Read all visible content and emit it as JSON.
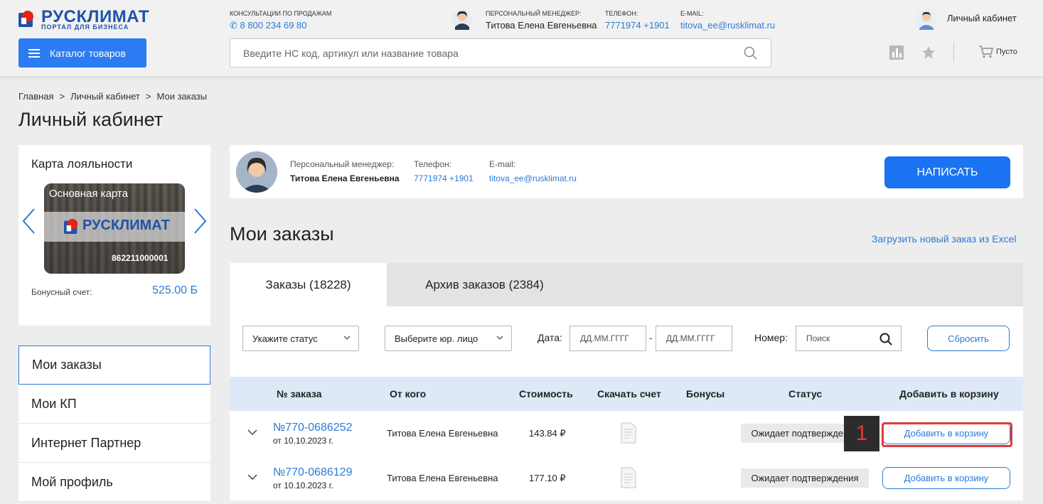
{
  "header": {
    "logo_text": "РУСКЛИМАТ",
    "logo_sub": "ПОРТАЛ ДЛЯ БИЗНЕСА",
    "catalog_label": "Каталог товаров",
    "consult_label": "КОНСУЛЬТАЦИИ ПО ПРОДАЖАМ",
    "consult_phone": "8 800 234 69 80",
    "manager_label": "ПЕРСОНАЛЬНЫЙ МЕНЕДЖЕР:",
    "manager_name": "Титова Елена Евгеньевна",
    "phone_label": "ТЕЛЕФОН:",
    "phone_value": "7771974 +1901",
    "email_label": "E-MAIL:",
    "email_value": "titova_ee@rusklimat.ru",
    "search_placeholder": "Введите НС код, артикул или название товара",
    "account_label": "Личный кабинет",
    "cart_label": "Пусто"
  },
  "breadcrumb": [
    "Главная",
    "Личный кабинет",
    "Мои заказы"
  ],
  "page_title": "Личный кабинет",
  "loyalty": {
    "title": "Карта лояльности",
    "card_title": "Основная карта",
    "card_brand": "РУСКЛИМАТ",
    "card_number": "862211000001",
    "bonus_label": "Бонусный счет:",
    "bonus_value": "525.00 Б"
  },
  "sidemenu": [
    "Мои заказы",
    "Мои КП",
    "Интернет Партнер",
    "Мой профиль"
  ],
  "manager_panel": {
    "manager_label": "Персональный менеджер:",
    "manager_name": "Титова Елена Евгеньевна",
    "phone_label": "Телефон:",
    "phone_value": "7771974 +1901",
    "email_label": "E-mail:",
    "email_value": "titova_ee@rusklimat.ru",
    "write_label": "НАПИСАТЬ"
  },
  "orders": {
    "title": "Мои заказы",
    "excel_link": "Загрузить новый заказ из Excel",
    "tabs": [
      "Заказы (18228)",
      "Архив заказов (2384)"
    ],
    "filters": {
      "status_placeholder": "Укажите статус",
      "entity_placeholder": "Выберите юр. лицо",
      "date_label": "Дата:",
      "date_from": "ДД.ММ.ГГГГ",
      "date_sep": "-",
      "date_to": "ДД.ММ.ГГГГ",
      "number_label": "Номер:",
      "number_placeholder": "Поиск",
      "reset_label": "Сбросить"
    },
    "columns": [
      "№ заказа",
      "От кого",
      "Стоимость",
      "Скачать счет",
      "Бонусы",
      "Статус",
      "Добавить в корзину"
    ],
    "rows": [
      {
        "number": "№770-0686252",
        "date": "от 10.10.2023 г.",
        "from": "Титова Елена Евгеньевна",
        "cost": "143.84 ₽",
        "status": "Ожидает подтверждения",
        "action": "Добавить в корзину"
      },
      {
        "number": "№770-0686129",
        "date": "от 10.10.2023 г.",
        "from": "Титова Елена Евгеньевна",
        "cost": "177.10 ₽",
        "status": "Ожидает подтверждения",
        "action": "Добавить в корзину"
      }
    ]
  },
  "annotation": {
    "badge": "1",
    "color": "#e23a33"
  },
  "colors": {
    "accent": "#2b7bf2",
    "link": "#2b7bd6",
    "brand": "#1f53a8"
  }
}
